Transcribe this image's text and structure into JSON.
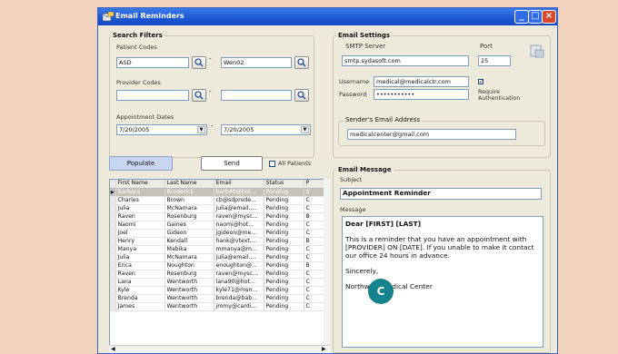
{
  "window": {
    "title": "Email Reminders",
    "min": "_",
    "max": "□",
    "close": "×"
  },
  "search": {
    "title": "Search Filters",
    "patient_label": "Patient Codes",
    "patient_from": "ASD",
    "patient_to": "Wen02",
    "provider_label": "Provider Codes",
    "provider_from": "",
    "provider_to": "",
    "dates_label": "Appointment Dates",
    "date_from": "7/20/2005",
    "date_to": "7/20/2005",
    "dash": "-"
  },
  "actions": {
    "populate": "Populate",
    "send": "Send",
    "all_patients": "All Patients"
  },
  "settings": {
    "title": "Email Settings",
    "smtp_label": "SMTP Server",
    "smtp_value": "smtp.sydasoft.com",
    "port_label": "Port",
    "port_value": "25",
    "username_label": "Username",
    "username_value": "medical@medicalctr.com",
    "password_label": "Password",
    "password_value": "•••••••••••",
    "require_auth": "Require Authentication",
    "sender_title": "Sender's Email Address",
    "sender_value": "medicalcenter@gmail.com"
  },
  "message": {
    "title": "Email Message",
    "subject_label": "Subject",
    "subject_value": "Appointment Reminder",
    "body_label": "Message",
    "greeting": "Dear [FIRST] [LAST]",
    "body": "This is a reminder that you have an appointment with [PROVIDER] ON [DATE]. If you unable to make it contact our office 24 hours in advance.",
    "closing": "Sincerely,",
    "signature": "Northwest Medical Center"
  },
  "grid": {
    "columns": [
      "First Name",
      "Last Name",
      "Email",
      "Status",
      "P"
    ],
    "rows": [
      [
        "Barbara",
        "Broderick",
        "barb49@hot...",
        "Pending",
        "S"
      ],
      [
        "Charles",
        "Brown",
        "cb@sdprode...",
        "Pending",
        "C"
      ],
      [
        "Julia",
        "McNamara",
        "julia@email....",
        "Pending",
        "C"
      ],
      [
        "Raven",
        "Rosenburg",
        "raven@mysc...",
        "Pending",
        "B"
      ],
      [
        "Naomi",
        "Gaines",
        "naomi@hot...",
        "Pending",
        "C"
      ],
      [
        "Joel",
        "Gideon",
        "jgideon@me...",
        "Pending",
        "C"
      ],
      [
        "Henry",
        "Kendall",
        "hank@vtext....",
        "Pending",
        "B"
      ],
      [
        "Manya",
        "Mabika",
        "mmanya@m...",
        "Pending",
        "C"
      ],
      [
        "Julia",
        "McNamara",
        "julia@email....",
        "Pending",
        "C"
      ],
      [
        "Erica",
        "Noughton",
        "enoughton@...",
        "Pending",
        "B"
      ],
      [
        "Raven",
        "Rosenburg",
        "raven@mysc...",
        "Pending",
        "C"
      ],
      [
        "Lana",
        "Wentworth",
        "lana90@hot...",
        "Pending",
        "C"
      ],
      [
        "Kyle",
        "Wentworth",
        "kyle71@msn...",
        "Pending",
        "C"
      ],
      [
        "Brenda",
        "Wentworth",
        "brenda@bab...",
        "Pending",
        "C"
      ],
      [
        "James",
        "Wentworth",
        "jmmy@cardi...",
        "Pending",
        "C"
      ]
    ]
  },
  "badge": "C",
  "colors": {
    "titlebar": "#1c56d4",
    "background": "#f0d2bf",
    "badge": "#15838b"
  }
}
